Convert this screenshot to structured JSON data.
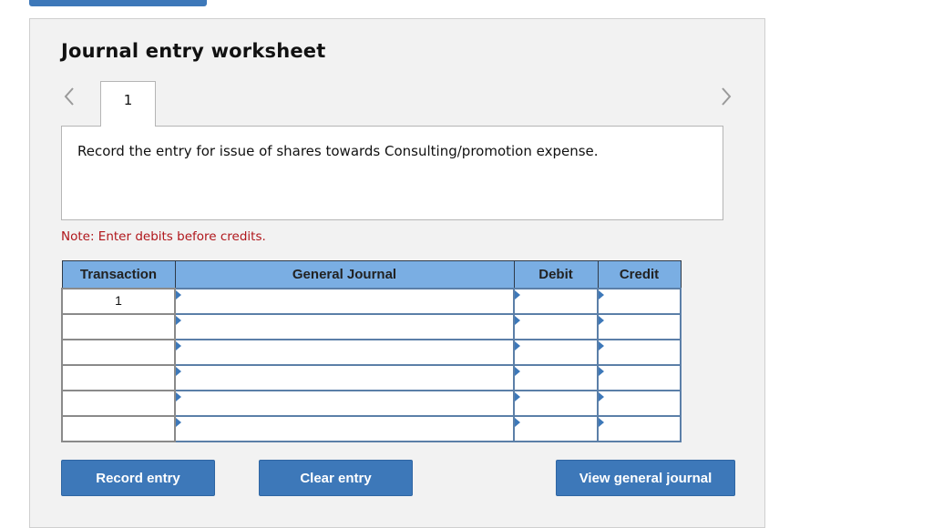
{
  "worksheet": {
    "title": "Journal entry worksheet",
    "tabs": [
      {
        "label": "1"
      }
    ],
    "prev_icon": "chevron-left-icon",
    "next_icon": "chevron-right-icon",
    "prompt": "Record the entry for issue of shares towards Consulting/promotion expense.",
    "note": "Note: Enter debits before credits."
  },
  "table": {
    "headers": [
      "Transaction",
      "General Journal",
      "Debit",
      "Credit"
    ],
    "rows": [
      {
        "transaction": "1",
        "account": "",
        "debit": "",
        "credit": ""
      },
      {
        "transaction": "",
        "account": "",
        "debit": "",
        "credit": ""
      },
      {
        "transaction": "",
        "account": "",
        "debit": "",
        "credit": ""
      },
      {
        "transaction": "",
        "account": "",
        "debit": "",
        "credit": ""
      },
      {
        "transaction": "",
        "account": "",
        "debit": "",
        "credit": ""
      },
      {
        "transaction": "",
        "account": "",
        "debit": "",
        "credit": ""
      }
    ]
  },
  "buttons": {
    "record": "Record entry",
    "clear": "Clear entry",
    "view": "View general journal"
  },
  "colors": {
    "accent": "#3d78b9",
    "header_bg": "#7aaee3",
    "note": "#b0161b",
    "panel_bg": "#f2f2f2"
  }
}
